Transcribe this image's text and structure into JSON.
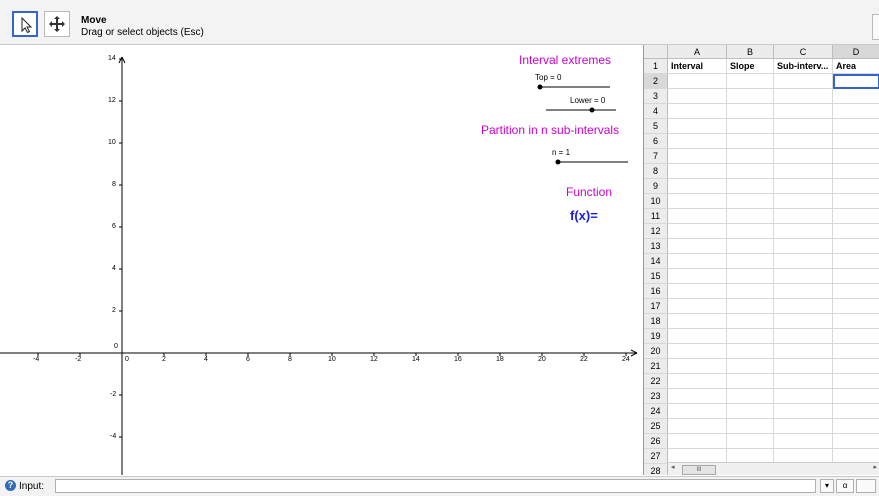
{
  "toolbar": {
    "active_tool_icon": "pointer-arrow-icon",
    "second_tool_icon": "move-graphics-view-icon",
    "tool_name": "Move",
    "tool_help": "Drag or select objects (Esc)"
  },
  "graphics": {
    "x_ticks": [
      "-4",
      "-2",
      "0",
      "2",
      "4",
      "6",
      "8",
      "10",
      "12",
      "14",
      "16",
      "18",
      "20",
      "22",
      "24"
    ],
    "y_ticks": [
      "14",
      "12",
      "10",
      "8",
      "6",
      "4",
      "2",
      "0",
      "-2",
      "-4"
    ],
    "interval_title": "Interval extremes",
    "top_slider_label": "Top = 0",
    "lower_slider_label": "Lower = 0",
    "partition_title": "Partition in n sub-intervals",
    "n_slider_label": "n = 1",
    "function_title": "Function",
    "function_text": "f(x)=",
    "text_color": "#cc00cc",
    "function_color": "#1a1ae6"
  },
  "spreadsheet": {
    "columns": [
      "A",
      "B",
      "C",
      "D"
    ],
    "selected_column": "D",
    "header_cells": [
      "Interval",
      "Slope",
      "Sub-interv...",
      "Area"
    ],
    "rows": [
      "1",
      "2",
      "3",
      "4",
      "5",
      "6",
      "7",
      "8",
      "9",
      "10",
      "11",
      "12",
      "13",
      "14",
      "15",
      "16",
      "17",
      "18",
      "19",
      "20",
      "21",
      "22",
      "23",
      "24",
      "25",
      "26",
      "27",
      "28"
    ],
    "selected_row": "2",
    "selected_cell": "D2",
    "scrollbar_thumb": "III"
  },
  "input_bar": {
    "label": "Input:",
    "value": "",
    "symbol_button": "α",
    "dropdown_button": "▾",
    "help_icon": "help-icon"
  }
}
